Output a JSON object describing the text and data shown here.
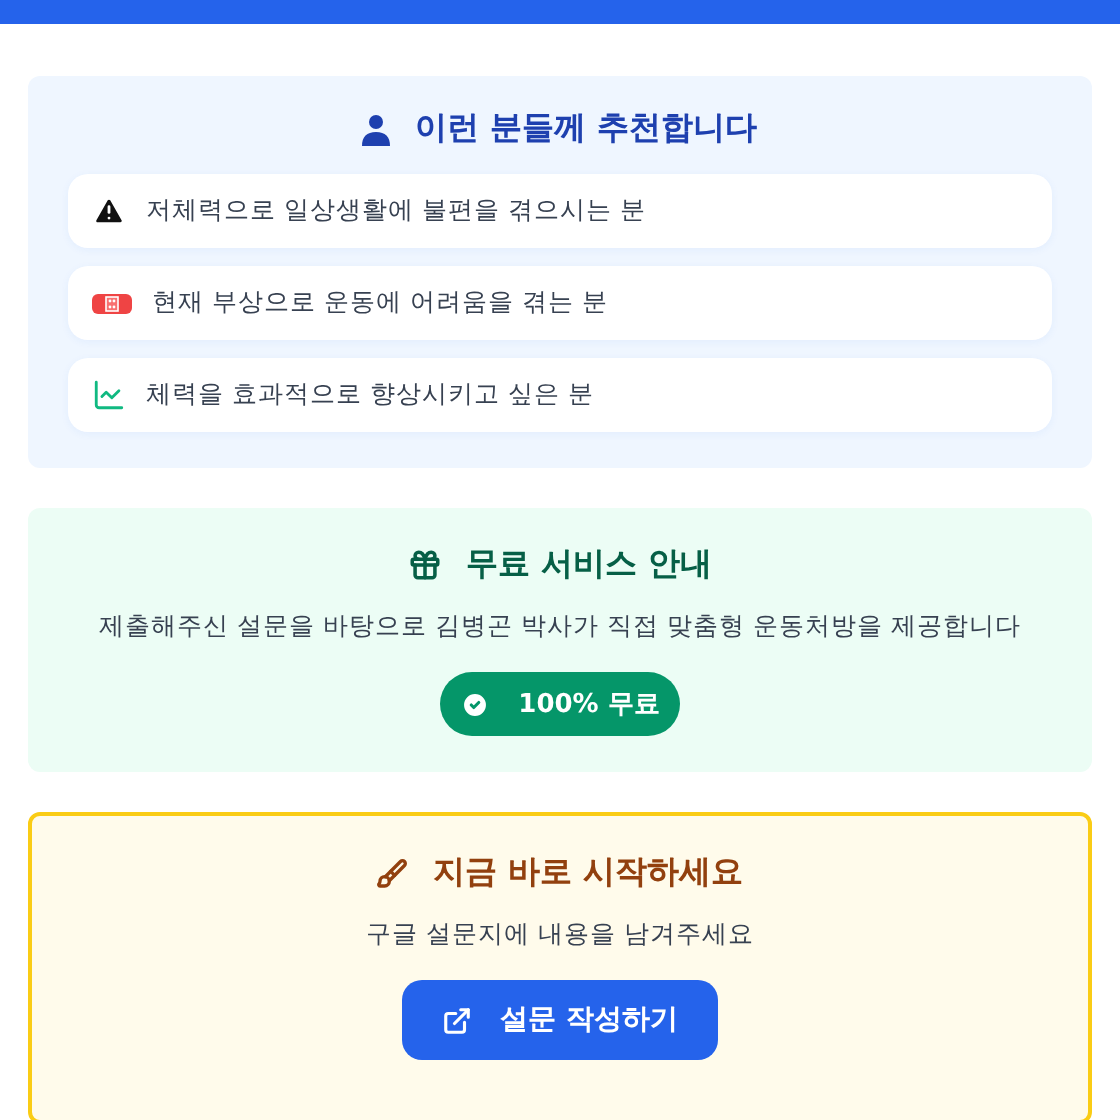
{
  "recommend": {
    "title": "이런 분들께 추천합니다",
    "items": [
      {
        "kind": "warning",
        "text": "저체력으로 일상생활에 불편을 겪으시는 분"
      },
      {
        "kind": "injury",
        "text": "현재 부상으로 운동에 어려움을 겪는 분"
      },
      {
        "kind": "growth",
        "text": "체력을 효과적으로 향상시키고 싶은 분"
      }
    ]
  },
  "free": {
    "title": "무료 서비스 안내",
    "description": "제출해주신 설문을 바탕으로 김병곤 박사가 직접 맞춤형 운동처방을 제공합니다",
    "badge": "100% 무료"
  },
  "start": {
    "title": "지금 바로 시작하세요",
    "description": "구글 설문지에 내용을 남겨주세요",
    "button": "설문 작성하기"
  }
}
